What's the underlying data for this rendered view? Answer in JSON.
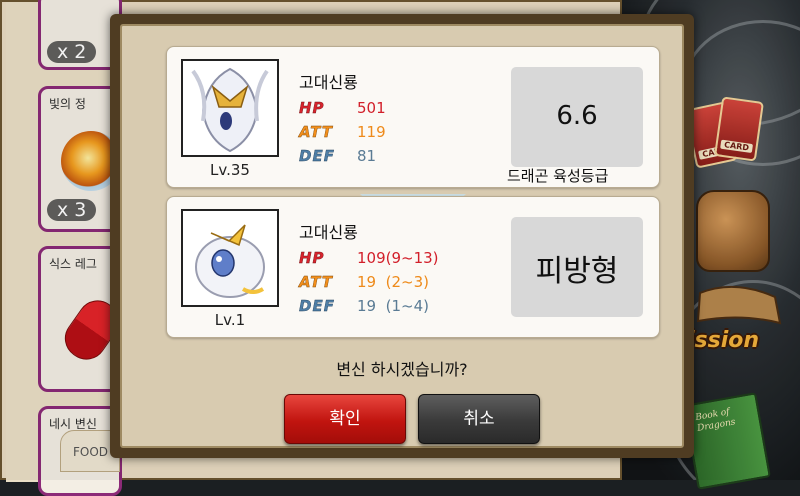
{
  "inventory": {
    "items": [
      {
        "title": "",
        "count": "x 2"
      },
      {
        "title": "빛의 정",
        "count": "x 3"
      },
      {
        "title": "식스 레그",
        "count": ""
      },
      {
        "title": "네시 변신",
        "count": ""
      }
    ],
    "food_tab": "FOOD"
  },
  "right_menu": {
    "card_label": "CARD",
    "mission_label": "ission",
    "book_label": "Book of Dragons"
  },
  "dialog": {
    "current": {
      "name": "고대신룡",
      "level": "Lv.35",
      "stats": {
        "hp_key": "HP",
        "hp": "501",
        "att_key": "ATT",
        "att": "119",
        "def_key": "DEF",
        "def": "81"
      },
      "grade_value": "6.6",
      "grade_label": "드래곤 육성등급"
    },
    "next": {
      "name": "고대신룡",
      "level": "Lv.1",
      "stats": {
        "hp_key": "HP",
        "hp": "109(9~13)",
        "att_key": "ATT",
        "att": "19  (2~3)",
        "def_key": "DEF",
        "def": "19  (1~4)"
      },
      "type": "피방형"
    },
    "question": "변신 하시겠습니까?",
    "confirm_label": "확인",
    "cancel_label": "취소"
  },
  "colors": {
    "hp": "#d21f2a",
    "att": "#ee8a1a",
    "def": "#5a7b94",
    "confirm": "#c1140f",
    "cancel": "#3a3a3a"
  }
}
